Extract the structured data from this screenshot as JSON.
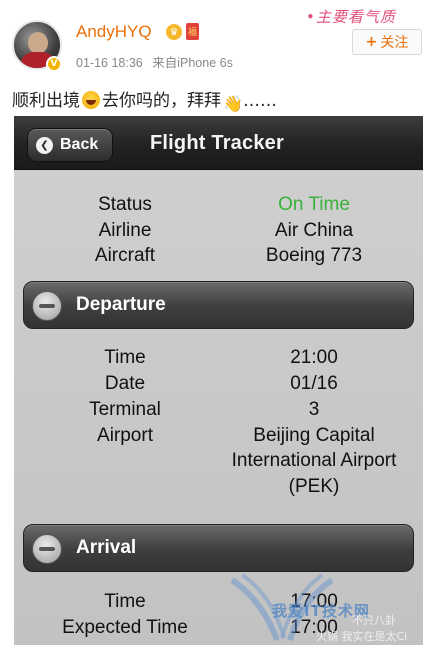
{
  "post": {
    "username": "AndyHYQ",
    "time": "01-16 18:36",
    "source": "来自iPhone 6s",
    "follow_label": "关注",
    "text_part1": "顺利出境",
    "text_part2": "去你吗的，拜拜",
    "text_part3": "……",
    "brand_watermark": "•主要看气质"
  },
  "app": {
    "nav_title": "Flight Tracker",
    "back_label": "Back",
    "summary": [
      {
        "key": "Status",
        "value": "On Time"
      },
      {
        "key": "Airline",
        "value": "Air China"
      },
      {
        "key": "Aircraft",
        "value": "Boeing 773"
      }
    ],
    "departure": {
      "title": "Departure",
      "rows": [
        {
          "key": "Time",
          "value": "21:00"
        },
        {
          "key": "Date",
          "value": "01/16"
        },
        {
          "key": "Terminal",
          "value": "3"
        },
        {
          "key": "Airport",
          "value": "Beijing Capital"
        },
        {
          "key": "",
          "value": "International Airport"
        },
        {
          "key": "",
          "value": "(PEK)"
        }
      ]
    },
    "arrival": {
      "title": "Arrival",
      "rows": [
        {
          "key": "Time",
          "value": "17:00"
        },
        {
          "key": "Expected Time",
          "value": "17:00"
        }
      ]
    },
    "colors": {
      "status_ok": "#3ab23a",
      "username": "#e8710a"
    }
  },
  "watermarks": {
    "site": "我爱IT技术网",
    "line1": "不只八卦",
    "line2": "火锅 我实在是太Ci"
  }
}
